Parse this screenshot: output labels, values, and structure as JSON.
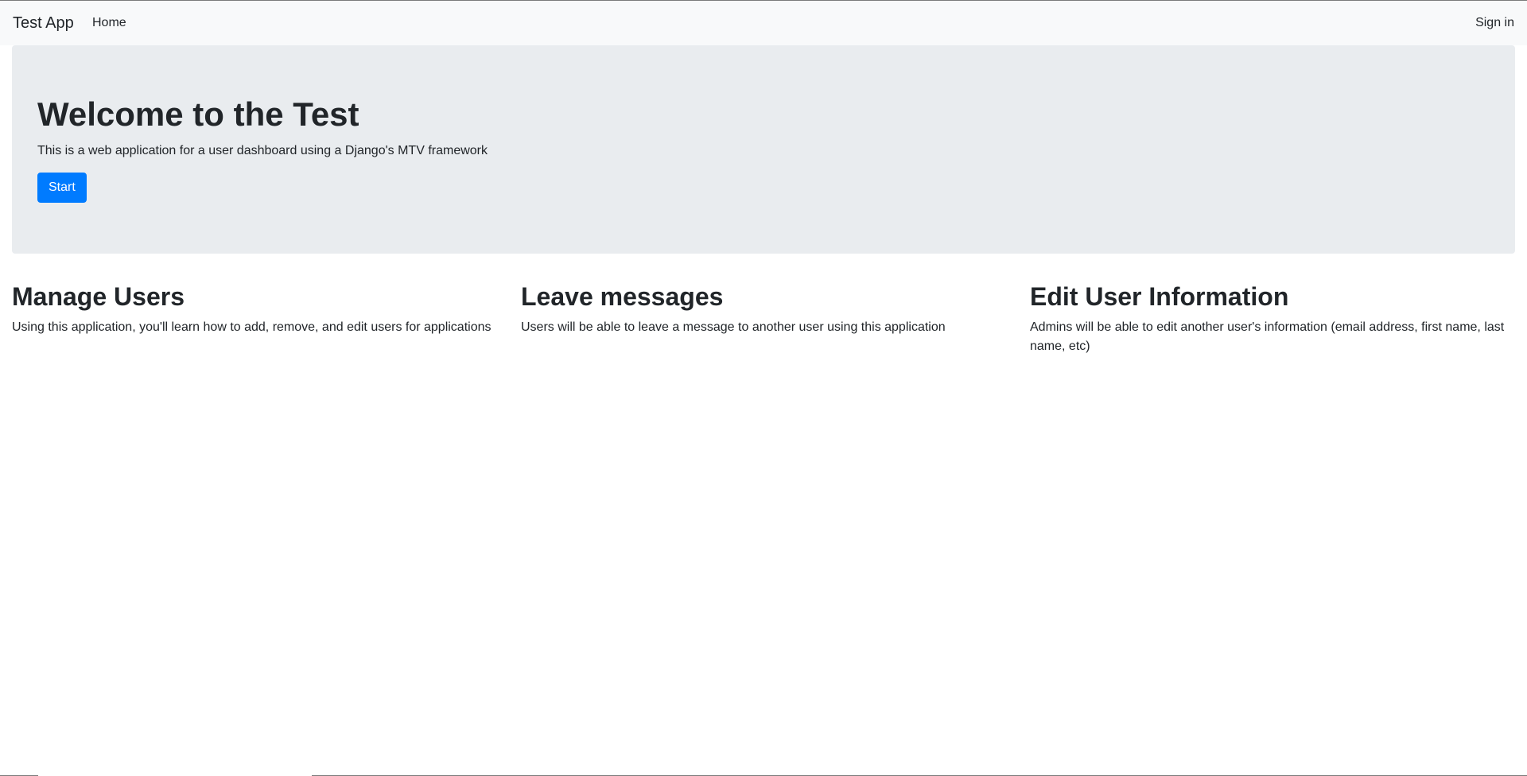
{
  "navbar": {
    "brand": "Test App",
    "links": [
      {
        "label": "Home"
      }
    ],
    "sign_in": "Sign in"
  },
  "hero": {
    "title": "Welcome to the Test",
    "lead": "This is a web application for a user dashboard using a Django's MTV framework",
    "button_label": "Start",
    "button_color": "#007bff",
    "background_color": "#e9ecef"
  },
  "features": [
    {
      "title": "Manage Users",
      "text": "Using this application, you'll learn how to add, remove, and edit users for applications"
    },
    {
      "title": "Leave messages",
      "text": "Users will be able to leave a message to another user using this application"
    },
    {
      "title": "Edit User Information",
      "text": "Admins will be able to edit another user's information (email address, first name, last name, etc)"
    }
  ]
}
